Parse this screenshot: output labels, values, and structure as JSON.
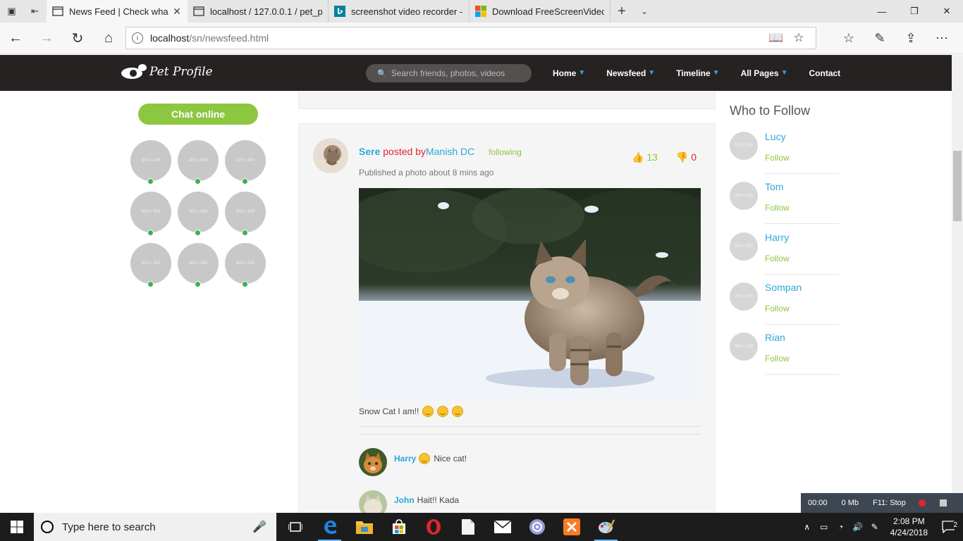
{
  "browser": {
    "tabs": [
      {
        "title": "News Feed | Check wha",
        "active": true,
        "close": "✕"
      },
      {
        "title": "localhost / 127.0.0.1 / pet_p"
      },
      {
        "title": "screenshot video recorder -"
      },
      {
        "title": "Download FreeScreenVideo"
      }
    ],
    "new_tab": "+",
    "url_host": "localhost",
    "url_path": "/sn/newsfeed.html"
  },
  "site": {
    "logo_text": "Pet Profile",
    "search_placeholder": "Search friends, photos, videos",
    "nav": [
      {
        "label": "Home",
        "caret": true
      },
      {
        "label": "Newsfeed",
        "caret": true
      },
      {
        "label": "Timeline",
        "caret": true
      },
      {
        "label": "All Pages",
        "caret": true
      },
      {
        "label": "Contact",
        "caret": false
      }
    ]
  },
  "left": {
    "chat_button": "Chat online",
    "friend_placeholder": "300 x 300",
    "online_count": 9
  },
  "post": {
    "author": "Sere",
    "posted_by": "posted by",
    "poster": "Manish DC",
    "following": "following",
    "meta": "Published a photo about 8 mins ago",
    "likes": "13",
    "dislikes": "0",
    "caption": "Snow Cat I am!!",
    "comments": [
      {
        "name": "Harry",
        "text": "Nice cat!"
      },
      {
        "name": "John",
        "text": "Hait!! Kada"
      }
    ]
  },
  "who_to_follow": {
    "title": "Who to Follow",
    "placeholder": "300 x 300",
    "follow_label": "Follow",
    "people": [
      "Lucy",
      "Tom",
      "Harry",
      "Sompan",
      "Rian"
    ]
  },
  "recorder": {
    "time": "00:00",
    "size": "0 Mb",
    "hint": "F11: Stop"
  },
  "taskbar": {
    "search_placeholder": "Type here to search",
    "time": "2:08 PM",
    "date": "4/24/2018",
    "notifications": "2"
  },
  "colors": {
    "header_bg": "#262222",
    "accent_blue": "#2fa7dc",
    "accent_green": "#8dc63f",
    "accent_red": "#e2252d",
    "online_dot": "#3cb34a"
  }
}
